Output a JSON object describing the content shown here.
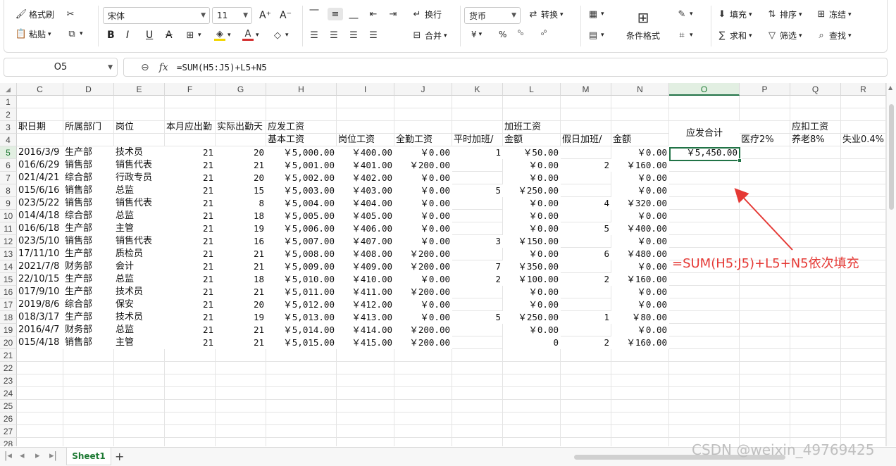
{
  "ribbon": {
    "format_painter": "格式刷",
    "paste": "粘贴",
    "font_name": "宋体",
    "font_size": "11",
    "wrap": "换行",
    "merge": "合并",
    "number_format": "货币",
    "convert": "转换",
    "cond_format": "条件格式",
    "fill": "填充",
    "sort": "排序",
    "freeze": "冻结",
    "sum": "求和",
    "filter": "筛选",
    "find": "查找",
    "percent": "%",
    "yen": "¥"
  },
  "formula_bar": {
    "name_box": "O5",
    "fx": "fx",
    "formula": "=SUM(H5:J5)+L5+N5"
  },
  "columns": [
    "C",
    "D",
    "E",
    "F",
    "G",
    "H",
    "I",
    "J",
    "K",
    "L",
    "M",
    "N",
    "O",
    "P",
    "Q",
    "R"
  ],
  "active_column": "O",
  "row_numbers": [
    "1",
    "2",
    "3",
    "4",
    "5",
    "6",
    "7",
    "8",
    "9",
    "10",
    "11",
    "12",
    "13",
    "14",
    "15",
    "16",
    "17",
    "18",
    "19",
    "20",
    "21",
    "22",
    "23",
    "24",
    "25",
    "26",
    "27",
    "28"
  ],
  "headers": {
    "row3": {
      "C": "职日期",
      "D": "所属部门",
      "E": "岗位",
      "F": "本月应出勤",
      "G": "实际出勤天",
      "H": "应发工资",
      "L": "加班工资",
      "Q": "应扣工资"
    },
    "row4": {
      "H": "基本工资",
      "I": "岗位工资",
      "J": "全勤工资",
      "K": "平时加班/",
      "L": "金额",
      "M": "假日加班/",
      "N": "金额",
      "P": "医疗2%",
      "Q": "养老8%",
      "R": "失业0.4%"
    },
    "O_merged": "应发合计"
  },
  "rows": [
    {
      "C": "2016/3/9",
      "D": "生产部",
      "E": "技术员",
      "F": "21",
      "G": "20",
      "H": "￥5,000.00",
      "I": "￥400.00",
      "J": "￥0.00",
      "K": "1",
      "L": "￥50.00",
      "M": "",
      "N": "￥0.00",
      "O": "￥5,450.00"
    },
    {
      "C": "016/6/29",
      "D": "销售部",
      "E": "销售代表",
      "F": "21",
      "G": "21",
      "H": "￥5,001.00",
      "I": "￥401.00",
      "J": "￥200.00",
      "K": "",
      "L": "￥0.00",
      "M": "2",
      "N": "￥160.00",
      "O": ""
    },
    {
      "C": "021/4/21",
      "D": "综合部",
      "E": "行政专员",
      "F": "21",
      "G": "20",
      "H": "￥5,002.00",
      "I": "￥402.00",
      "J": "￥0.00",
      "K": "",
      "L": "￥0.00",
      "M": "",
      "N": "￥0.00",
      "O": ""
    },
    {
      "C": "015/6/16",
      "D": "销售部",
      "E": "总监",
      "F": "21",
      "G": "15",
      "H": "￥5,003.00",
      "I": "￥403.00",
      "J": "￥0.00",
      "K": "5",
      "L": "￥250.00",
      "M": "",
      "N": "￥0.00",
      "O": ""
    },
    {
      "C": "023/5/22",
      "D": "销售部",
      "E": "销售代表",
      "F": "21",
      "G": "8",
      "H": "￥5,004.00",
      "I": "￥404.00",
      "J": "￥0.00",
      "K": "",
      "L": "￥0.00",
      "M": "4",
      "N": "￥320.00",
      "O": ""
    },
    {
      "C": "014/4/18",
      "D": "综合部",
      "E": "总监",
      "F": "21",
      "G": "18",
      "H": "￥5,005.00",
      "I": "￥405.00",
      "J": "￥0.00",
      "K": "",
      "L": "￥0.00",
      "M": "",
      "N": "￥0.00",
      "O": ""
    },
    {
      "C": "016/6/18",
      "D": "生产部",
      "E": "主管",
      "F": "21",
      "G": "19",
      "H": "￥5,006.00",
      "I": "￥406.00",
      "J": "￥0.00",
      "K": "",
      "L": "￥0.00",
      "M": "5",
      "N": "￥400.00",
      "O": ""
    },
    {
      "C": "023/5/10",
      "D": "销售部",
      "E": "销售代表",
      "F": "21",
      "G": "16",
      "H": "￥5,007.00",
      "I": "￥407.00",
      "J": "￥0.00",
      "K": "3",
      "L": "￥150.00",
      "M": "",
      "N": "￥0.00",
      "O": ""
    },
    {
      "C": "17/11/10",
      "D": "生产部",
      "E": "质检员",
      "F": "21",
      "G": "21",
      "H": "￥5,008.00",
      "I": "￥408.00",
      "J": "￥200.00",
      "K": "",
      "L": "￥0.00",
      "M": "6",
      "N": "￥480.00",
      "O": ""
    },
    {
      "C": "2021/7/8",
      "D": "财务部",
      "E": "会计",
      "F": "21",
      "G": "21",
      "H": "￥5,009.00",
      "I": "￥409.00",
      "J": "￥200.00",
      "K": "7",
      "L": "￥350.00",
      "M": "",
      "N": "￥0.00",
      "O": ""
    },
    {
      "C": "22/10/15",
      "D": "生产部",
      "E": "总监",
      "F": "21",
      "G": "18",
      "H": "￥5,010.00",
      "I": "￥410.00",
      "J": "￥0.00",
      "K": "2",
      "L": "￥100.00",
      "M": "2",
      "N": "￥160.00",
      "O": ""
    },
    {
      "C": "017/9/10",
      "D": "生产部",
      "E": "技术员",
      "F": "21",
      "G": "21",
      "H": "￥5,011.00",
      "I": "￥411.00",
      "J": "￥200.00",
      "K": "",
      "L": "￥0.00",
      "M": "",
      "N": "￥0.00",
      "O": ""
    },
    {
      "C": "2019/8/6",
      "D": "综合部",
      "E": "保安",
      "F": "21",
      "G": "20",
      "H": "￥5,012.00",
      "I": "￥412.00",
      "J": "￥0.00",
      "K": "",
      "L": "￥0.00",
      "M": "",
      "N": "￥0.00",
      "O": ""
    },
    {
      "C": "018/3/17",
      "D": "生产部",
      "E": "技术员",
      "F": "21",
      "G": "19",
      "H": "￥5,013.00",
      "I": "￥413.00",
      "J": "￥0.00",
      "K": "5",
      "L": "￥250.00",
      "M": "1",
      "N": "￥80.00",
      "O": ""
    },
    {
      "C": "2016/4/7",
      "D": "财务部",
      "E": "总监",
      "F": "21",
      "G": "21",
      "H": "￥5,014.00",
      "I": "￥414.00",
      "J": "￥200.00",
      "K": "",
      "L": "￥0.00",
      "M": "",
      "N": "￥0.00",
      "O": ""
    },
    {
      "C": "015/4/18",
      "D": "销售部",
      "E": "主管",
      "F": "21",
      "G": "21",
      "H": "￥5,015.00",
      "I": "￥415.00",
      "J": "￥200.00",
      "K": "",
      "L": "0",
      "M": "2",
      "N": "￥160.00",
      "O": ""
    }
  ],
  "annotation": "=SUM(H5:J5)+L5+N5依次填充",
  "sheet_tab": "Sheet1",
  "watermark": "CSDN @weixin_49769425",
  "colors": {
    "accent": "#217346",
    "annotation": "#e53935"
  }
}
